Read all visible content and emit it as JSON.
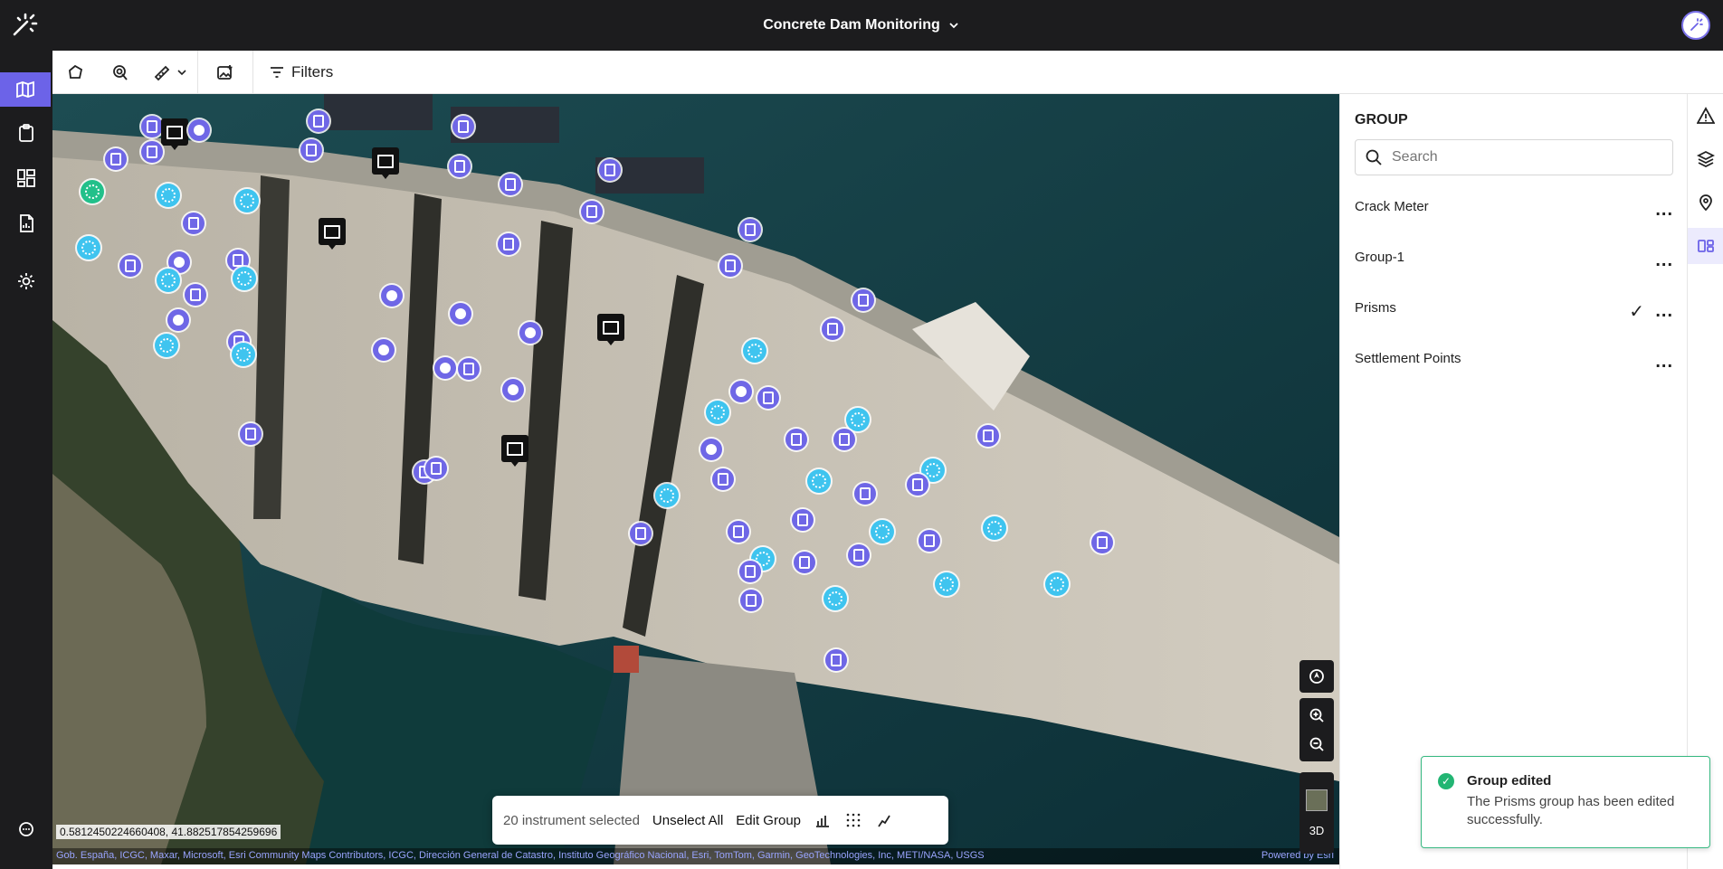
{
  "header": {
    "project_title": "Concrete Dam Monitoring",
    "logo_icon": "sparkle-logo-icon",
    "avatar_icon": "user-avatar-icon"
  },
  "left_nav": {
    "items": [
      {
        "icon": "map-icon",
        "active": true
      },
      {
        "icon": "clipboard-icon",
        "active": false
      },
      {
        "icon": "dashboard-icon",
        "active": false
      },
      {
        "icon": "report-icon",
        "active": false
      },
      {
        "icon": "settings-icon",
        "active": false
      },
      {
        "icon": "chat-icon",
        "active": false
      }
    ]
  },
  "toolbar": {
    "tools": [
      "polygon-select-icon",
      "point-select-icon",
      "measure-icon",
      "image-add-icon"
    ],
    "filters_label": "Filters"
  },
  "map": {
    "coordinates": "0.5812450224660408, 41.882517854259696",
    "attribution": "Gob. España, ICGC, Maxar, Microsoft, Esri Community Maps Contributors, ICGC, Dirección General de Catastro, Instituto Geográfico Nacional, Esri, TomTom, Garmin, GeoTechnologies, Inc, METI/NASA, USGS",
    "powered_by": "Powered by Esri",
    "view_3d_label": "3D",
    "controls": [
      "compass-icon",
      "zoom-in-icon",
      "zoom-out-icon",
      "basemap-thumbnail-icon"
    ]
  },
  "selection_bar": {
    "count_text": "20 instrument selected",
    "unselect_label": "Unselect All",
    "edit_group_label": "Edit Group",
    "actions": [
      "bar-chart-icon",
      "grid-dots-icon",
      "line-chart-icon"
    ]
  },
  "group_panel": {
    "title": "GROUP",
    "search_placeholder": "Search",
    "groups": [
      {
        "name": "Crack Meter",
        "checked": false
      },
      {
        "name": "Group-1",
        "checked": false
      },
      {
        "name": "Prisms",
        "checked": true
      },
      {
        "name": "Settlement Points",
        "checked": false
      }
    ]
  },
  "right_rail": {
    "items": [
      "alert-triangle-icon",
      "layers-icon",
      "location-pin-icon",
      "group-icon"
    ]
  },
  "toast": {
    "title": "Group edited",
    "message": "The Prisms group has been edited successfully.",
    "status_color": "#22b573"
  },
  "colors": {
    "accent": "#6c63e8",
    "topbar": "#1c1c1e",
    "marker_purple": "#6f67e6",
    "marker_cyan": "#3fc4ef"
  }
}
